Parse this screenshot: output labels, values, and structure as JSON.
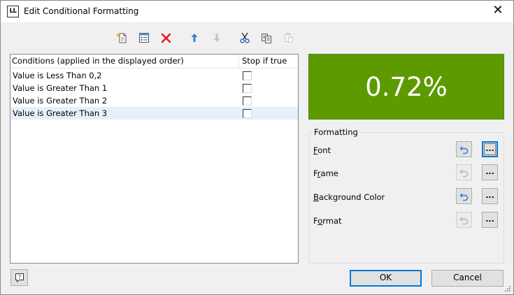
{
  "window": {
    "title": "Edit Conditional Formatting",
    "app_icon_text": "LL",
    "close_glyph": "✕"
  },
  "toolbar": {
    "items": [
      {
        "name": "new-condition-icon",
        "enabled": true
      },
      {
        "name": "properties-icon",
        "enabled": true
      },
      {
        "name": "delete-icon",
        "enabled": true
      },
      {
        "name": "move-up-icon",
        "enabled": true
      },
      {
        "name": "move-down-icon",
        "enabled": false
      },
      {
        "name": "cut-icon",
        "enabled": true
      },
      {
        "name": "copy-icon",
        "enabled": true
      },
      {
        "name": "paste-icon",
        "enabled": false
      }
    ]
  },
  "conditions": {
    "columns": [
      "Conditions (applied in the displayed order)",
      "Stop if true"
    ],
    "rows": [
      {
        "condition": "Value is Less Than 0,2",
        "stop_if_true": false,
        "selected": false
      },
      {
        "condition": "Value is Greater Than 1",
        "stop_if_true": false,
        "selected": false
      },
      {
        "condition": "Value is Greater Than 2",
        "stop_if_true": false,
        "selected": false
      },
      {
        "condition": "Value is Greater Than 3",
        "stop_if_true": false,
        "selected": true
      }
    ]
  },
  "preview": {
    "value": "0.72%",
    "background": "#5c9a00",
    "text_color": "#ffffff"
  },
  "formatting": {
    "title": "Formatting",
    "items": [
      {
        "label": "Font",
        "reset_enabled": true,
        "more": "..."
      },
      {
        "label": "Frame",
        "reset_enabled": false,
        "more": "..."
      },
      {
        "label": "Background Color",
        "reset_enabled": true,
        "more": "..."
      },
      {
        "label": "Format",
        "reset_enabled": false,
        "more": "..."
      }
    ]
  },
  "buttons": {
    "ok": "OK",
    "cancel": "Cancel",
    "help_glyph": "?"
  },
  "colors": {
    "accent": "#0078d7",
    "delete_red": "#e81123",
    "arrow_blue": "#3b7bd4"
  }
}
